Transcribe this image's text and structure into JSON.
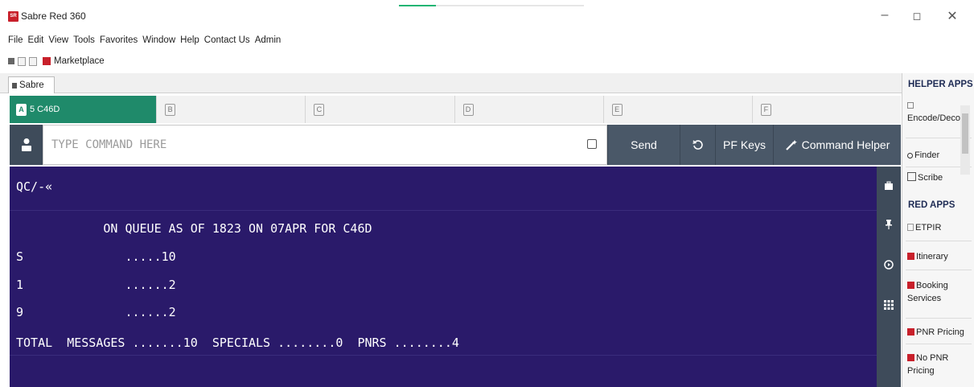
{
  "window": {
    "title": "Sabre Red 360",
    "logo_text": "SR",
    "loading_progress": 0.2,
    "controls": [
      "–",
      "◻",
      "✕"
    ]
  },
  "menu": [
    "File",
    "Edit",
    "View",
    "Tools",
    "Favorites",
    "Window",
    "Help",
    "Contact Us",
    "Admin"
  ],
  "toolbar": {
    "marketplace_label": "Marketplace"
  },
  "workspace_tab": {
    "label": "Sabre"
  },
  "session_tabs": [
    {
      "letter": "A",
      "label": "5 C46D",
      "active": true
    },
    {
      "letter": "B",
      "label": "",
      "active": false
    },
    {
      "letter": "C",
      "label": "",
      "active": false
    },
    {
      "letter": "D",
      "label": "",
      "active": false
    },
    {
      "letter": "E",
      "label": "",
      "active": false
    },
    {
      "letter": "F",
      "label": "",
      "active": false
    }
  ],
  "command": {
    "placeholder": "TYPE COMMAND HERE",
    "send_label": "Send",
    "pf_keys_label": "PF Keys",
    "command_helper_label": "Command Helper"
  },
  "terminal": {
    "command": "QC/-«",
    "lines": [
      "            ON QUEUE AS OF 1823 ON 07APR FOR C46D",
      "S              .....10",
      "1              ......2",
      "9              ......2",
      "TOTAL  MESSAGES .......10  SPECIALS ........0  PNRS ........4"
    ],
    "background": "#2a1a6a"
  },
  "right_panel": {
    "helper_header": "HELPER APPS",
    "helper_items": [
      "Encode/Decode",
      "Finder",
      "Scribe"
    ],
    "red_header": "RED APPS",
    "red_items": [
      "ETPIR",
      "Itinerary",
      "Booking Services",
      "PNR Pricing",
      "No PNR Pricing"
    ]
  },
  "colors": {
    "accent": "#1f8a6a",
    "toolbar_dark": "#4a5868",
    "brand_red": "#c8202b"
  }
}
